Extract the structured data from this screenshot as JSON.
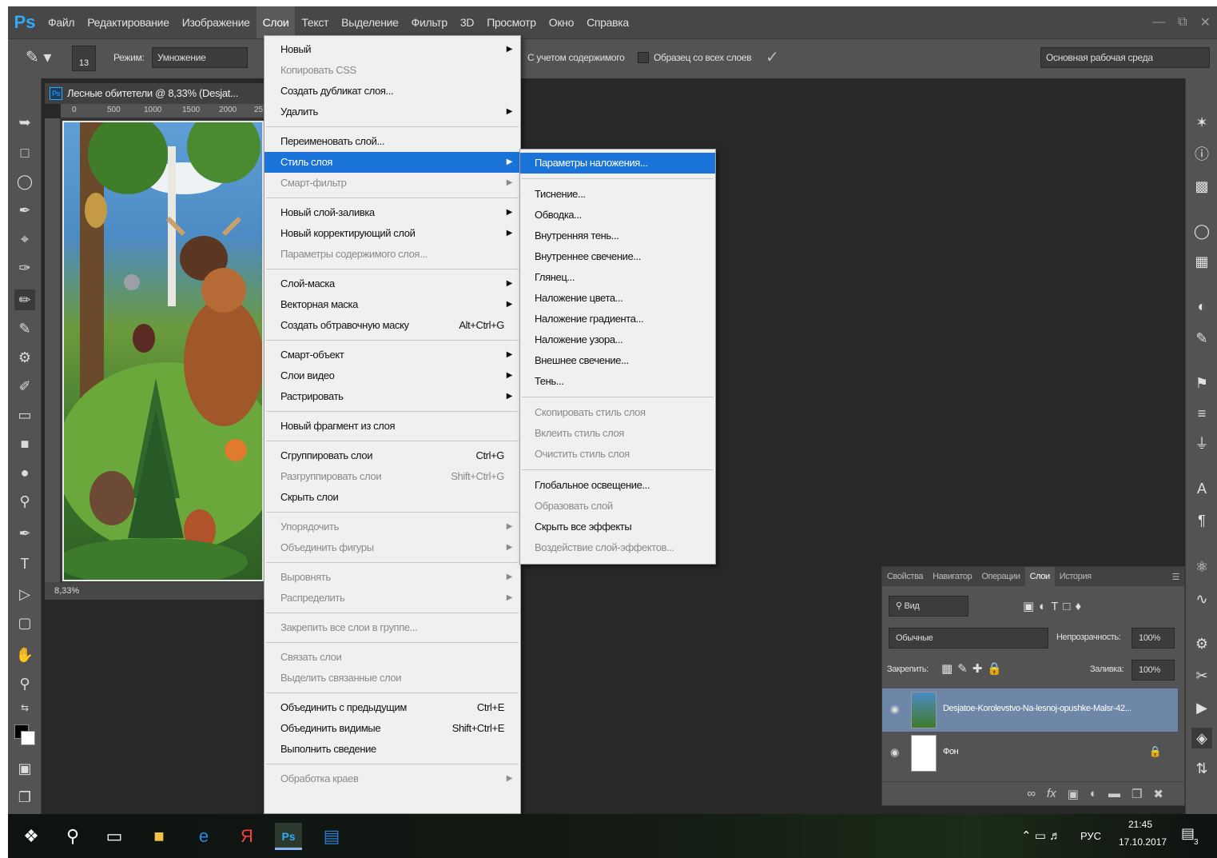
{
  "app": {
    "logo": "Ps",
    "menubar": [
      "Файл",
      "Редактирование",
      "Изображение",
      "Слои",
      "Текст",
      "Выделение",
      "Фильтр",
      "3D",
      "Просмотр",
      "Окно",
      "Справка"
    ]
  },
  "options": {
    "brush_size": "13",
    "mode_label": "Режим:",
    "mode_value": "Умножение",
    "sample_content": "С учетом содержимого",
    "sample_all": "Образец со всех слоев",
    "workspace": "Основная рабочая среда"
  },
  "document": {
    "tab_title": "Лесные обитетели @ 8,33% (Desjat...",
    "zoom": "8,33%",
    "ruler_ticks": [
      "0",
      "500",
      "1000",
      "1500",
      "2000",
      "25"
    ]
  },
  "layers_menu": {
    "items": [
      {
        "label": "Новый",
        "shortcut": "",
        "submenu": true,
        "disabled": false
      },
      {
        "label": "Копировать CSS",
        "shortcut": "",
        "submenu": false,
        "disabled": true
      },
      {
        "label": "Создать дубликат слоя...",
        "shortcut": "",
        "submenu": false,
        "disabled": false
      },
      {
        "label": "Удалить",
        "shortcut": "",
        "submenu": true,
        "disabled": false
      },
      {
        "label": "Переименовать слой...",
        "shortcut": "",
        "submenu": false,
        "disabled": false
      },
      {
        "label": "Стиль слоя",
        "shortcut": "",
        "submenu": true,
        "disabled": false,
        "highlighted": true
      },
      {
        "label": "Смарт-фильтр",
        "shortcut": "",
        "submenu": true,
        "disabled": true
      },
      {
        "label": "Новый слой-заливка",
        "shortcut": "",
        "submenu": true,
        "disabled": false
      },
      {
        "label": "Новый корректирующий слой",
        "shortcut": "",
        "submenu": true,
        "disabled": false
      },
      {
        "label": "Параметры содержимого слоя...",
        "shortcut": "",
        "submenu": false,
        "disabled": true
      },
      {
        "label": "Слой-маска",
        "shortcut": "",
        "submenu": true,
        "disabled": false
      },
      {
        "label": "Векторная маска",
        "shortcut": "",
        "submenu": true,
        "disabled": false
      },
      {
        "label": "Создать обтравочную маску",
        "shortcut": "Alt+Ctrl+G",
        "submenu": false,
        "disabled": false
      },
      {
        "label": "Смарт-объект",
        "shortcut": "",
        "submenu": true,
        "disabled": false
      },
      {
        "label": "Слои видео",
        "shortcut": "",
        "submenu": true,
        "disabled": false
      },
      {
        "label": "Растрировать",
        "shortcut": "",
        "submenu": true,
        "disabled": false
      },
      {
        "label": "Новый фрагмент из слоя",
        "shortcut": "",
        "submenu": false,
        "disabled": false
      },
      {
        "label": "Сгруппировать слои",
        "shortcut": "Ctrl+G",
        "submenu": false,
        "disabled": false
      },
      {
        "label": "Разгруппировать слои",
        "shortcut": "Shift+Ctrl+G",
        "submenu": false,
        "disabled": true
      },
      {
        "label": "Скрыть слои",
        "shortcut": "",
        "submenu": false,
        "disabled": false
      },
      {
        "label": "Упорядочить",
        "shortcut": "",
        "submenu": true,
        "disabled": true
      },
      {
        "label": "Объединить фигуры",
        "shortcut": "",
        "submenu": true,
        "disabled": true
      },
      {
        "label": "Выровнять",
        "shortcut": "",
        "submenu": true,
        "disabled": true
      },
      {
        "label": "Распределить",
        "shortcut": "",
        "submenu": true,
        "disabled": true
      },
      {
        "label": "Закрепить все слои в группе...",
        "shortcut": "",
        "submenu": false,
        "disabled": true
      },
      {
        "label": "Связать слои",
        "shortcut": "",
        "submenu": false,
        "disabled": true
      },
      {
        "label": "Выделить связанные слои",
        "shortcut": "",
        "submenu": false,
        "disabled": true
      },
      {
        "label": "Объединить с предыдущим",
        "shortcut": "Ctrl+E",
        "submenu": false,
        "disabled": false
      },
      {
        "label": "Объединить видимые",
        "shortcut": "Shift+Ctrl+E",
        "submenu": false,
        "disabled": false
      },
      {
        "label": "Выполнить сведение",
        "shortcut": "",
        "submenu": false,
        "disabled": false
      },
      {
        "label": "Обработка краев",
        "shortcut": "",
        "submenu": true,
        "disabled": true
      }
    ]
  },
  "style_submenu": {
    "items": [
      {
        "label": "Параметры наложения...",
        "disabled": false,
        "highlighted": true
      },
      {
        "label": "Тиснение...",
        "disabled": false
      },
      {
        "label": "Обводка...",
        "disabled": false
      },
      {
        "label": "Внутренняя тень...",
        "disabled": false
      },
      {
        "label": "Внутреннее свечение...",
        "disabled": false
      },
      {
        "label": "Глянец...",
        "disabled": false
      },
      {
        "label": "Наложение цвета...",
        "disabled": false
      },
      {
        "label": "Наложение градиента...",
        "disabled": false
      },
      {
        "label": "Наложение узора...",
        "disabled": false
      },
      {
        "label": "Внешнее свечение...",
        "disabled": false
      },
      {
        "label": "Тень...",
        "disabled": false
      },
      {
        "label": "Скопировать стиль слоя",
        "disabled": true
      },
      {
        "label": "Вклеить стиль слоя",
        "disabled": true
      },
      {
        "label": "Очистить стиль слоя",
        "disabled": true
      },
      {
        "label": "Глобальное освещение...",
        "disabled": false
      },
      {
        "label": "Образовать слой",
        "disabled": true
      },
      {
        "label": "Скрыть все эффекты",
        "disabled": false
      },
      {
        "label": "Воздействие слой-эффектов...",
        "disabled": true
      }
    ]
  },
  "layers_panel": {
    "tabs": [
      "Свойства",
      "Навигатор",
      "Операции",
      "Слои",
      "История"
    ],
    "active_tab": "Слои",
    "filter": "Вид",
    "blend_mode": "Обычные",
    "opacity_label": "Непрозрачность:",
    "opacity": "100%",
    "lock_label": "Закрепить:",
    "fill_label": "Заливка:",
    "fill": "100%",
    "layers": [
      {
        "name": "Desjatoe-Korolevstvo-Na-lesnoj-opushke-Malsr-42...",
        "selected": true
      },
      {
        "name": "Фон",
        "selected": false,
        "locked": true
      }
    ]
  },
  "taskbar": {
    "lang": "РУС",
    "time": "21:45",
    "date": "17.10.2017",
    "notifications": "3"
  },
  "colors": {
    "accent": "#1a73d9",
    "ps_blue": "#31a8ff",
    "workspace_bg": "#282828",
    "panel_bg": "#535353"
  }
}
